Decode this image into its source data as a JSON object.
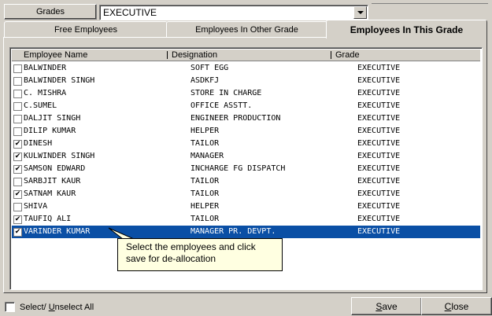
{
  "grade": {
    "label": "Grades",
    "selected": "EXECUTIVE"
  },
  "tabs": [
    {
      "label": "Free Employees"
    },
    {
      "label": "Employees In Other Grade"
    },
    {
      "label": "Employees In This Grade"
    }
  ],
  "columns": {
    "name": "Employee Name",
    "designation": "Designation",
    "grade": "Grade"
  },
  "rows": [
    {
      "name": "BALWINDER",
      "designation": "SOFT EGG",
      "grade": "EXECUTIVE",
      "checked": false
    },
    {
      "name": "BALWINDER SINGH",
      "designation": "ASDKFJ",
      "grade": "EXECUTIVE",
      "checked": false
    },
    {
      "name": "C. MISHRA",
      "designation": "STORE IN CHARGE",
      "grade": "EXECUTIVE",
      "checked": false
    },
    {
      "name": "C.SUMEL",
      "designation": "OFFICE ASSTT.",
      "grade": "EXECUTIVE",
      "checked": false
    },
    {
      "name": "DALJIT SINGH",
      "designation": "ENGINEER PRODUCTION",
      "grade": "EXECUTIVE",
      "checked": false
    },
    {
      "name": "DILIP KUMAR",
      "designation": "HELPER",
      "grade": "EXECUTIVE",
      "checked": false
    },
    {
      "name": "DINESH",
      "designation": "TAILOR",
      "grade": "EXECUTIVE",
      "checked": true
    },
    {
      "name": "KULWINDER SINGH",
      "designation": "MANAGER",
      "grade": "EXECUTIVE",
      "checked": true
    },
    {
      "name": "SAMSON EDWARD",
      "designation": "INCHARGE FG DISPATCH",
      "grade": "EXECUTIVE",
      "checked": true
    },
    {
      "name": "SARBJIT KAUR",
      "designation": "TAILOR",
      "grade": "EXECUTIVE",
      "checked": false
    },
    {
      "name": "SATNAM KAUR",
      "designation": "TAILOR",
      "grade": "EXECUTIVE",
      "checked": true
    },
    {
      "name": "SHIVA",
      "designation": "HELPER",
      "grade": "EXECUTIVE",
      "checked": false
    },
    {
      "name": "TAUFIQ ALI",
      "designation": "TAILOR",
      "grade": "EXECUTIVE",
      "checked": true
    },
    {
      "name": "VARINDER KUMAR",
      "designation": "MANAGER PR. DEVPT.",
      "grade": "EXECUTIVE",
      "checked": true,
      "selected": true
    }
  ],
  "tooltip": {
    "line1": "Select the employees and click",
    "line2": "save for de-allocation"
  },
  "select_all": {
    "pre": "Select/ ",
    "underlined": "U",
    "post": "nselect All"
  },
  "buttons": {
    "save": {
      "underlined": "S",
      "rest": "ave"
    },
    "close": {
      "underlined": "C",
      "rest": "lose"
    }
  },
  "colors": {
    "selection": "#0a4fa5",
    "tooltip_bg": "#ffffe1",
    "face": "#d4d0c8"
  }
}
